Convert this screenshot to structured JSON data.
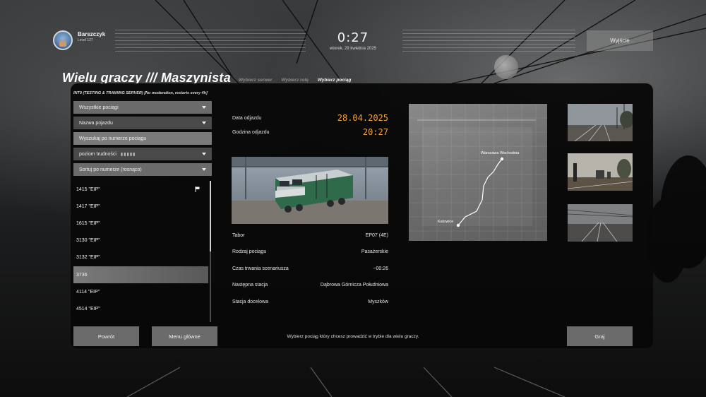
{
  "player": {
    "name": "Barszczyk",
    "level": "Level 127"
  },
  "clock": {
    "time": "0:27",
    "date": "wtorek, 29 kwietnia 2025"
  },
  "header": {
    "exit_label": "Wyjście"
  },
  "title": "Wielu graczy /// Maszynista",
  "breadcrumbs": [
    {
      "label": "Wybierz serwer",
      "active": false
    },
    {
      "label": "Wybierz rolę",
      "active": false
    },
    {
      "label": "Wybierz pociąg",
      "active": true
    }
  ],
  "server": "INT0 (TESTING & TRAINING SERVER) [No moderation, restarts every 4h]",
  "filters": {
    "all_trains": "Wszystkie pociągi",
    "vehicle_name": "Nazwa pojazdu",
    "search_placeholder": "Wyszukaj po numerze pociągu",
    "difficulty": "poziom trudności",
    "difficulty_level": 0,
    "sort": "Sortuj po numerze (rosnąco)"
  },
  "trains": [
    {
      "label": "1415 \"EIP\"",
      "selected": false,
      "flag": true
    },
    {
      "label": "1417 \"EIP\"",
      "selected": false,
      "flag": false
    },
    {
      "label": "1615 \"EIP\"",
      "selected": false,
      "flag": false
    },
    {
      "label": "3130 \"EIP\"",
      "selected": false,
      "flag": false
    },
    {
      "label": "3132 \"EIP\"",
      "selected": false,
      "flag": false
    },
    {
      "label": "3736",
      "selected": true,
      "flag": false
    },
    {
      "label": "4114 \"EIP\"",
      "selected": false,
      "flag": false
    },
    {
      "label": "4514 \"EIP\"",
      "selected": false,
      "flag": false
    }
  ],
  "departure": {
    "date_label": "Data odjazdu",
    "date_value": "28.04.2025",
    "time_label": "Godzina odjazdu",
    "time_value": "20:27"
  },
  "details": [
    {
      "label": "Tabor",
      "value": "EP07 (4E)"
    },
    {
      "label": "Rodzaj pociągu",
      "value": "Pasażerskie"
    },
    {
      "label": "Czas trwania scenariusza",
      "value": "~00:26"
    },
    {
      "label": "Następna stacja",
      "value": "Dąbrowa Górnicza Południowa"
    },
    {
      "label": "Stacja docelowa",
      "value": "Myszków"
    }
  ],
  "map": {
    "start": "Katowice",
    "end": "Warszawa Wschodnia"
  },
  "footer": {
    "back_label": "Powrót",
    "menu_label": "Menu główne",
    "hint": "Wybierz pociąg który chcesz prowadzić w trybie dla wielu graczy.",
    "play_label": "Graj"
  },
  "colors": {
    "accent": "#f4a23b",
    "panel": "#080808",
    "button": "#6b6b6b"
  }
}
